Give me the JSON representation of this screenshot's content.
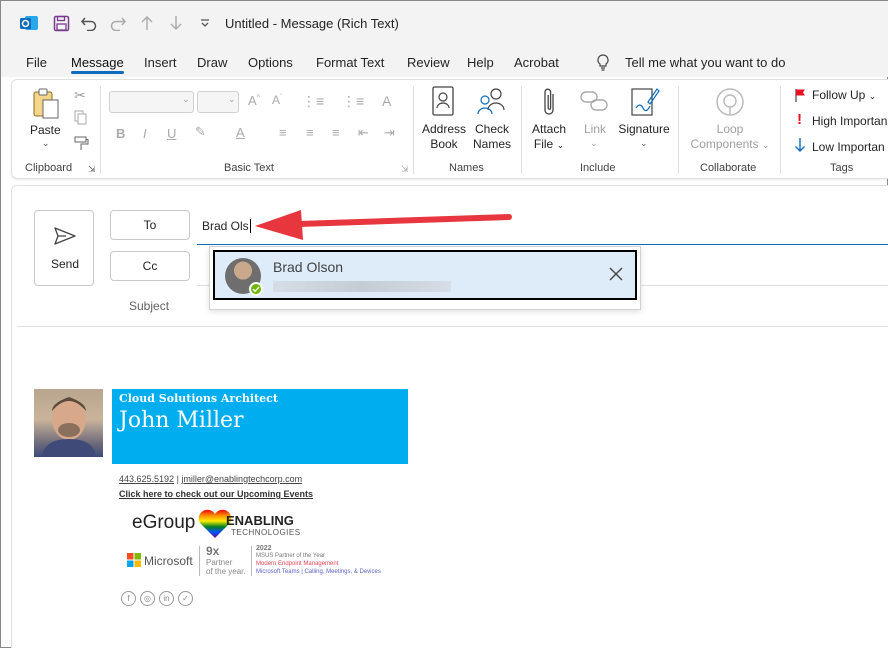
{
  "window": {
    "title": "Untitled - Message (Rich Text)"
  },
  "menu": {
    "tabs": [
      "File",
      "Message",
      "Insert",
      "Draw",
      "Options",
      "Format Text",
      "Review",
      "Help",
      "Acrobat"
    ],
    "active": "Message",
    "search": "Tell me what you want to do"
  },
  "ribbon": {
    "clipboard": {
      "paste": "Paste",
      "label": "Clipboard"
    },
    "basic_text": {
      "label": "Basic Text"
    },
    "names": {
      "address_book": [
        "Address",
        "Book"
      ],
      "check_names": [
        "Check",
        "Names"
      ],
      "label": "Names"
    },
    "include": {
      "attach": [
        "Attach",
        "File"
      ],
      "link": "Link",
      "signature": "Signature",
      "label": "Include"
    },
    "collaborate": {
      "loop": [
        "Loop",
        "Components"
      ],
      "label": "Collaborate"
    },
    "tags": {
      "follow_up": "Follow Up",
      "high": "High Importan",
      "low": "Low Importan",
      "label": "Tags"
    }
  },
  "compose": {
    "send": "Send",
    "to_button": "To",
    "cc_button": "Cc",
    "to_value": "Brad Ols",
    "subject_label": "Subject"
  },
  "suggestion": {
    "name": "Brad Olson"
  },
  "signature": {
    "role": "Cloud Solutions Architect",
    "name": "John Miller",
    "phone": "443.625.5192",
    "email": "jmiller@enablingtechcorp.com",
    "events": "Click here to check out our Upcoming Events",
    "egroup": "eGroup",
    "enabling": "ENABLING",
    "technologies": "TECHNOLOGIES",
    "microsoft": "Microsoft",
    "nine_x": "9x",
    "partner": [
      "Partner",
      "of the year."
    ],
    "award_year": "2022",
    "award_lines": [
      "MSUS Partner of the Year",
      "Modern Endpoint Management",
      "Microsoft Teams | Calling, Meetings, & Devices"
    ]
  },
  "colors": {
    "accent": "#0f6cbd",
    "banner": "#00aeef",
    "arrow": "#e8363f",
    "suggest_bg": "#deecf9"
  }
}
